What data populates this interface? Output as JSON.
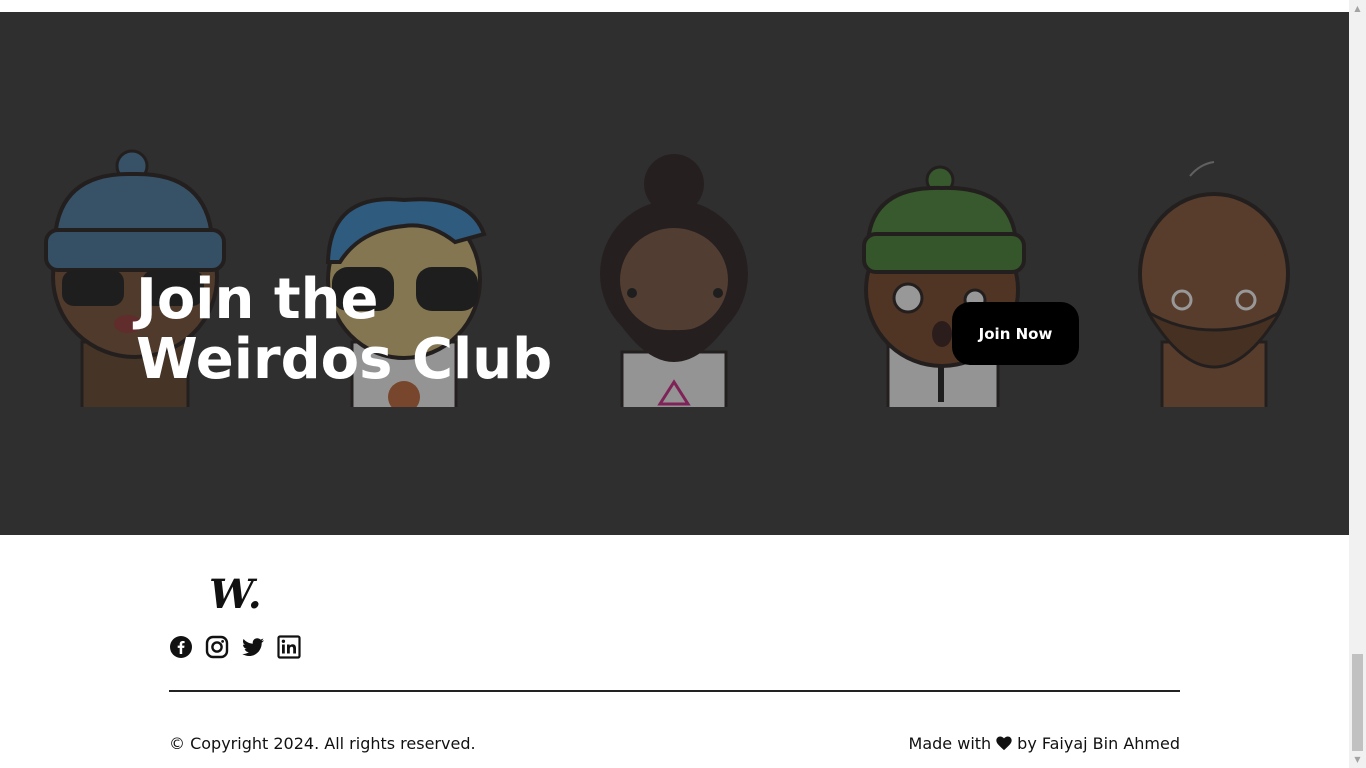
{
  "hero": {
    "title_line1": "Join the",
    "title_line2": "Weirdos Club",
    "cta_label": "Join Now",
    "bg_color": "#2f2f2f",
    "characters": [
      "beanie-sunglasses-weirdo",
      "bluehair-sunglasses-weirdo",
      "bun-beard-weirdo",
      "green-beanie-monocle-weirdo",
      "bald-beard-glasses-weirdo"
    ]
  },
  "footer": {
    "logo_text": "W.",
    "social_icons": [
      "facebook-icon",
      "instagram-icon",
      "twitter-icon",
      "linkedin-icon"
    ],
    "copyright": "© Copyright 2024. All rights reserved.",
    "made_with_prefix": "Made with",
    "made_with_suffix": "by Faiyaj Bin Ahmed",
    "heart_icon": "heart-icon"
  },
  "scrollbar": {
    "up_arrow": "▲",
    "down_arrow": "▼"
  }
}
